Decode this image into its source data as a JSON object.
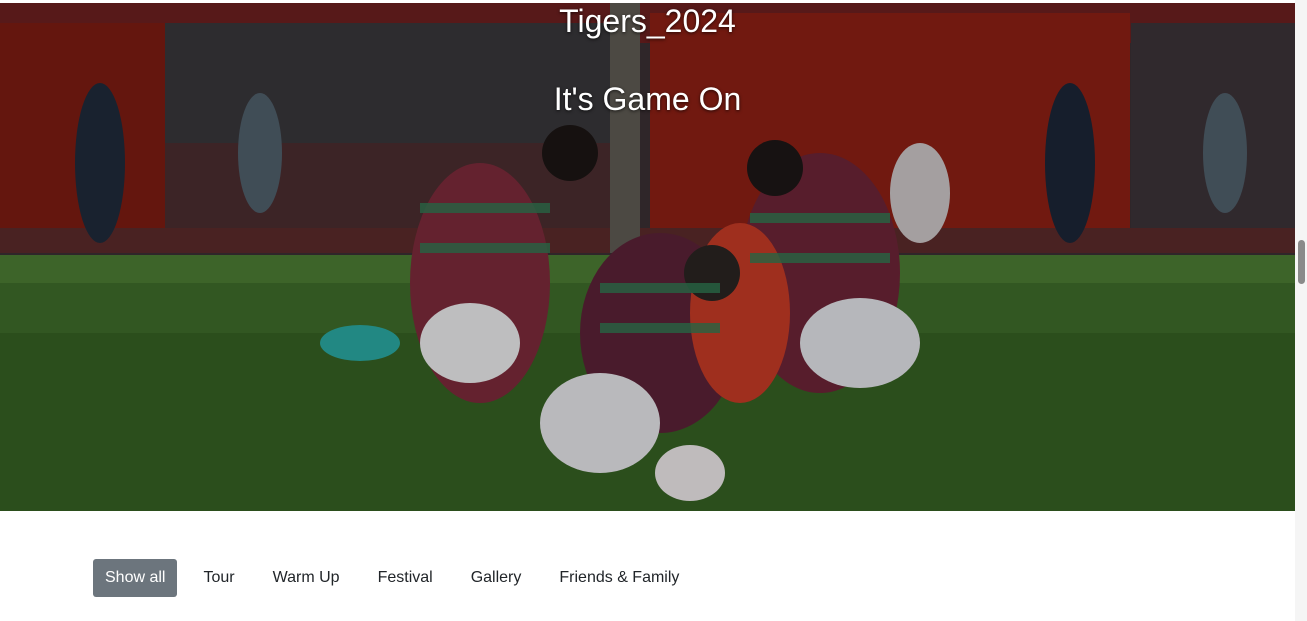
{
  "hero": {
    "title": "Tigers_2024",
    "subtitle": "It's Game On",
    "image_icon": "rugby-match-photo"
  },
  "filters": {
    "items": [
      {
        "label": "Show all",
        "active": true
      },
      {
        "label": "Tour",
        "active": false
      },
      {
        "label": "Warm Up",
        "active": false
      },
      {
        "label": "Festival",
        "active": false
      },
      {
        "label": "Gallery",
        "active": false
      },
      {
        "label": "Friends & Family",
        "active": false
      }
    ]
  },
  "colors": {
    "active_filter_bg": "#6c757d",
    "active_filter_text": "#ffffff",
    "filter_text": "#212529"
  }
}
